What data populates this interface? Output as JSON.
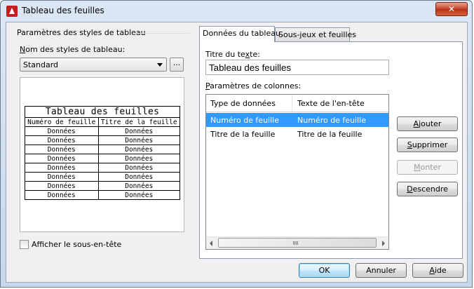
{
  "window": {
    "title": "Tableau des feuilles",
    "close_glyph": "✕",
    "app_icon": "autocad-icon"
  },
  "left": {
    "group_title": "Paramètres des styles de tableau",
    "style_label": "Nom des styles de tableau:",
    "style_value": "Standard",
    "browse_label": "...",
    "preview": {
      "title": "Tableau des feuilles",
      "headers": [
        "Numéro de feuille",
        "Titre de la feuille"
      ],
      "rows": [
        [
          "Données",
          "Données"
        ],
        [
          "Données",
          "Données"
        ],
        [
          "Données",
          "Données"
        ],
        [
          "Données",
          "Données"
        ],
        [
          "Données",
          "Données"
        ],
        [
          "Données",
          "Données"
        ],
        [
          "Données",
          "Données"
        ],
        [
          "Données",
          "Données"
        ]
      ]
    },
    "subheader_checkbox": {
      "label": "Afficher le sous-en-tête",
      "checked": false
    }
  },
  "tabs": [
    {
      "label": "Données du tableau",
      "active": true
    },
    {
      "label": "Sous-jeux et feuilles",
      "active": false
    }
  ],
  "data_tab": {
    "title_label": "Titre du texte:",
    "title_value": "Tableau des feuilles",
    "columns_label": "Paramètres de colonnes:",
    "columns_headers": [
      "Type de données",
      "Texte de l'en-tête"
    ],
    "columns_rows": [
      {
        "type": "Numéro de feuille",
        "header": "Numéro de feuille",
        "selected": true
      },
      {
        "type": "Titre de la feuille",
        "header": "Titre de la feuille",
        "selected": false
      }
    ],
    "buttons": {
      "add": "Ajouter",
      "delete": "Supprimer",
      "up": "Monter",
      "down": "Descendre"
    }
  },
  "footer": {
    "ok": "OK",
    "cancel": "Annuler",
    "help": "Aide"
  }
}
